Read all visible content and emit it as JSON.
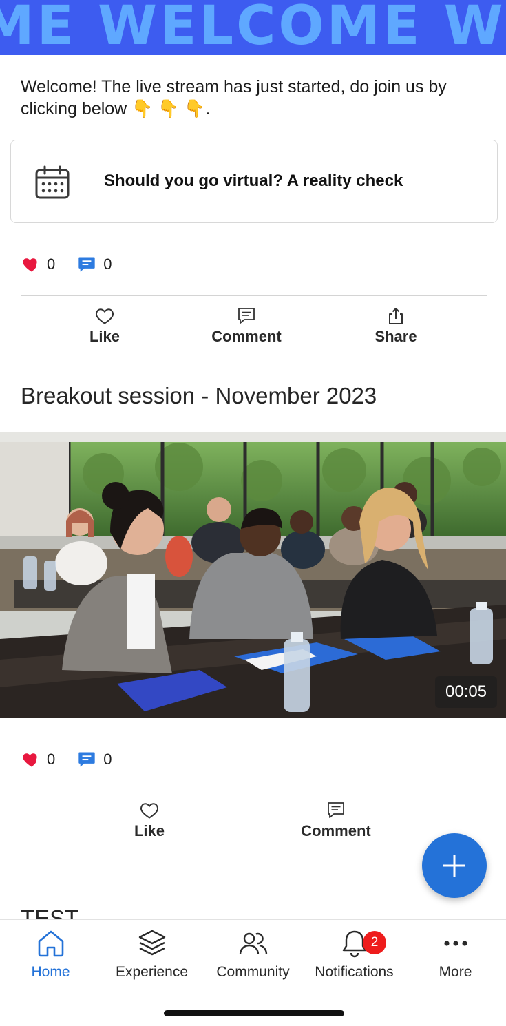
{
  "banner": {
    "text": "ME WELCOME W"
  },
  "post1": {
    "text": "Welcome! The live stream has just started, do join us by clicking below 👇 👇 👇.",
    "event_title": "Should you go virtual? A reality check",
    "likes": "0",
    "comments": "0",
    "actions": {
      "like": "Like",
      "comment": "Comment",
      "share": "Share"
    }
  },
  "post2": {
    "title": "Breakout session - November 2023",
    "video_duration": "00:05",
    "likes": "0",
    "comments": "0",
    "actions": {
      "like": "Like",
      "comment": "Comment"
    }
  },
  "post3": {
    "title": "TEST"
  },
  "tabbar": {
    "home": "Home",
    "experience": "Experience",
    "community": "Community",
    "notifications": "Notifications",
    "notifications_badge": "2",
    "more": "More"
  },
  "colors": {
    "banner_bg": "#3d5cf0",
    "banner_text": "#5fa8ff",
    "accent": "#2472d8",
    "heart": "#e8183f",
    "badge": "#ee1c1c"
  },
  "icons": [
    "calendar-icon",
    "heart-icon",
    "comment-bubble-icon",
    "like-outline-icon",
    "comment-outline-icon",
    "share-icon",
    "plus-icon",
    "home-icon",
    "layers-icon",
    "people-icon",
    "bell-icon",
    "more-dots-icon"
  ]
}
